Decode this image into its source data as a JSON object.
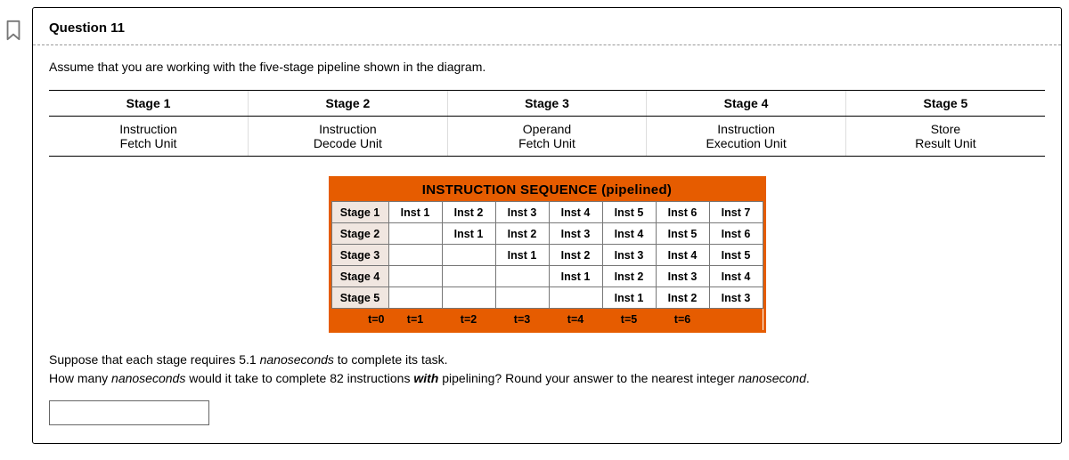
{
  "question": {
    "number_label": "Question 11",
    "prompt": "Assume that you are working with the five-stage pipeline shown in the diagram."
  },
  "stages": {
    "headers": [
      "Stage 1",
      "Stage 2",
      "Stage 3",
      "Stage 4",
      "Stage 5"
    ],
    "units_line1": [
      "Instruction",
      "Instruction",
      "Operand",
      "Instruction",
      "Store"
    ],
    "units_line2": [
      "Fetch Unit",
      "Decode Unit",
      "Fetch Unit",
      "Execution Unit",
      "Result Unit"
    ]
  },
  "sequence": {
    "title": "INSTRUCTION SEQUENCE (pipelined)",
    "row_labels": [
      "Stage 1",
      "Stage 2",
      "Stage 3",
      "Stage 4",
      "Stage 5"
    ],
    "rows": [
      [
        "Inst 1",
        "Inst 2",
        "Inst 3",
        "Inst 4",
        "Inst 5",
        "Inst 6",
        "Inst 7"
      ],
      [
        "",
        "Inst 1",
        "Inst 2",
        "Inst 3",
        "Inst 4",
        "Inst 5",
        "Inst 6"
      ],
      [
        "",
        "",
        "Inst 1",
        "Inst 2",
        "Inst 3",
        "Inst 4",
        "Inst 5"
      ],
      [
        "",
        "",
        "",
        "Inst 1",
        "Inst 2",
        "Inst 3",
        "Inst 4"
      ],
      [
        "",
        "",
        "",
        "",
        "Inst 1",
        "Inst 2",
        "Inst 3"
      ]
    ],
    "time_labels": [
      "t=0",
      "t=1",
      "t=2",
      "t=3",
      "t=4",
      "t=5",
      "t=6"
    ]
  },
  "followup": {
    "line1a": "Suppose that each stage requires 5.1",
    "line1b": " nanoseconds",
    "line1c": " to complete its task.",
    "line2a": "How many",
    "line2b": " nanoseconds",
    "line2c": " would it take to complete 82 instructions",
    "line2d": " with",
    "line2e": " pipelining? Round your answer to the nearest integer",
    "line2f": " nanosecond",
    "line2g": "."
  },
  "answer": {
    "value": ""
  }
}
